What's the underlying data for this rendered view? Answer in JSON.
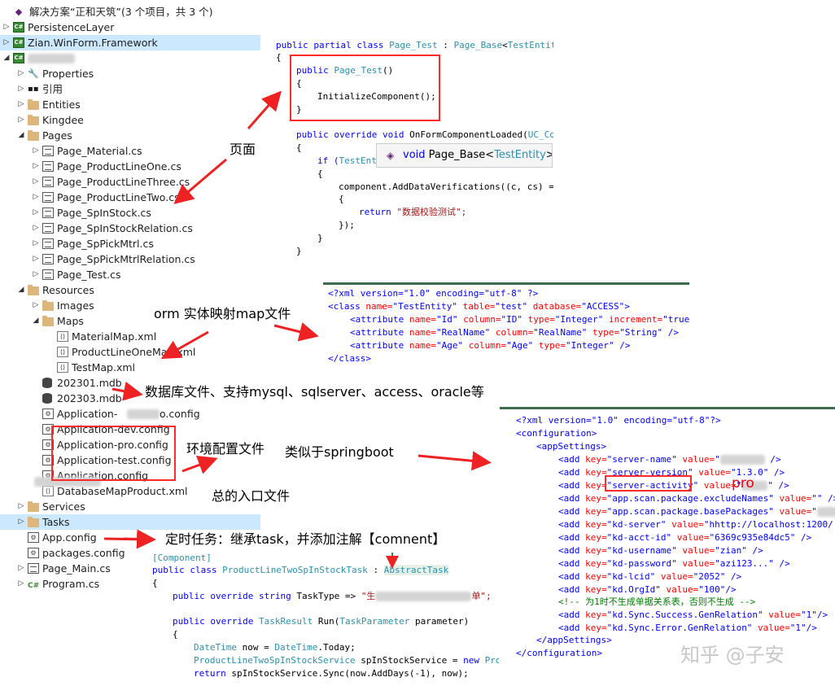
{
  "tree": {
    "solution": "解决方案“正和天筑”(3 个项目，共 3 个)",
    "items": [
      {
        "label": "PersistenceLayer"
      },
      {
        "label": "Zian.WinForm.Framework"
      },
      {
        "label": ""
      },
      {
        "label": "Properties"
      },
      {
        "label": "引用"
      },
      {
        "label": "Entities"
      },
      {
        "label": "Kingdee"
      },
      {
        "label": "Pages"
      },
      {
        "label": "Page_Material.cs"
      },
      {
        "label": "Page_ProductLineOne.cs"
      },
      {
        "label": "Page_ProductLineThree.cs"
      },
      {
        "label": "Page_ProductLineTwo.cs"
      },
      {
        "label": "Page_SpInStock.cs"
      },
      {
        "label": "Page_SpInStockRelation.cs"
      },
      {
        "label": "Page_SpPickMtrl.cs"
      },
      {
        "label": "Page_SpPickMtrlRelation.cs"
      },
      {
        "label": "Page_Test.cs"
      },
      {
        "label": "Resources"
      },
      {
        "label": "Images"
      },
      {
        "label": "Maps"
      },
      {
        "label": "MaterialMap.xml"
      },
      {
        "label": "ProductLineOneMap.xml"
      },
      {
        "label": "TestMap.xml"
      },
      {
        "label": "202301.mdb"
      },
      {
        "label": "202303.mdb"
      },
      {
        "label": "Application-"
      },
      {
        "label": "Application-dev.config"
      },
      {
        "label": "Application-pro.config"
      },
      {
        "label": "Application-test.config"
      },
      {
        "label": "Application.config"
      },
      {
        "label": "DatabaseMapProduct.xml"
      },
      {
        "label": "Services"
      },
      {
        "label": "Tasks"
      },
      {
        "label": "App.config"
      },
      {
        "label": "packages.config"
      },
      {
        "label": "Page_Main.cs"
      },
      {
        "label": "Program.cs"
      }
    ],
    "app_config_suffix": "o.config"
  },
  "code1": {
    "l1a": "public partial class ",
    "l1b": "Page_Test",
    "l1c": " : ",
    "l1d": "Page_Base",
    "l1e": "<",
    "l1f": "TestEntity",
    "l2": "{",
    "l3a": "public ",
    "l3b": "Page_Test",
    "l3c": "()",
    "l4": "{",
    "l5": "InitializeComponent();",
    "l6": "}",
    "l7a": "public override void ",
    "l7b": "OnFormComponentLoaded(",
    "l7c": "UC_Com",
    "l8": "{",
    "l9a": "if (",
    "l9b": "TestEnti",
    "l10": "{",
    "l11a": "component.",
    "l11b": "AddDataVerifications((c, cs) =>",
    "l12": "{",
    "l13a": "return ",
    "l13b": "\"数据校验测试\";",
    "l14": "});",
    "l15": "}",
    "l16": "}"
  },
  "tooltip": {
    "a": "void ",
    "b": "Page_Base",
    "c": "<",
    "d": "TestEntity",
    "e": ">.On"
  },
  "xml1": {
    "l1": "<?xml version=\"1.0\" encoding=\"utf-8\" ?>",
    "l2a": "<class ",
    "l2b": "name=",
    "l2c": "\"TestEntity\"",
    "l2d": " table=",
    "l2e": "\"test\"",
    "l2f": " database=",
    "l2g": "\"ACCESS\"",
    "l2h": ">",
    "l3a": "<attribute ",
    "l3b": "name=",
    "l3c": "\"Id\"",
    "l3d": " column=",
    "l3e": "\"ID\"",
    "l3f": " type=",
    "l3g": "\"Integer\"",
    "l3h": " increment=",
    "l3i": "\"true\"",
    "l4a": "<attribute ",
    "l4b": "name=",
    "l4c": "\"RealName\"",
    "l4d": " column=",
    "l4e": "\"RealName\"",
    "l4f": " type=",
    "l4g": "\"String\"",
    "l4h": " />",
    "l5a": "<attribute ",
    "l5b": "name=",
    "l5c": "\"Age\"",
    "l5d": " column=",
    "l5e": "\"Age\"",
    "l5f": " type=",
    "l5g": "\"Integer\"",
    "l5h": " />",
    "l6": "</class>"
  },
  "xml2": {
    "l1": "<?xml version=\"1.0\" encoding=\"utf-8\"?>",
    "l2": "<configuration>",
    "l3": "<appSettings>",
    "rows": [
      {
        "k": "\"server-name\"",
        "v": "\"",
        "t": " />"
      },
      {
        "k": "\"server-version\"",
        "v": "\"1.3.0\"",
        "t": " />"
      },
      {
        "k": "\"server-activity\"",
        "v": "\"",
        "t": "\" />"
      },
      {
        "k": "\"app.scan.package.excludeNames\"",
        "v": "\"\"",
        "t": " />"
      },
      {
        "k": "\"app.scan.package.basePackages\"",
        "v": "\"",
        "t": ""
      },
      {
        "k": "\"kd-server\"",
        "v": "\"hhttp://localhost:1200/",
        "t": ""
      },
      {
        "k": "\"kd-acct-id\"",
        "v": "\"6369c935e84dc5\"",
        "t": " />"
      },
      {
        "k": "\"kd-username\"",
        "v": "\"zian\"",
        "t": " />"
      },
      {
        "k": "\"kd-password\"",
        "v": "\"azi123...\"",
        "t": " />"
      },
      {
        "k": "\"kd-lcid\"",
        "v": "\"2052\"",
        "t": " />"
      },
      {
        "k": "\"kd.OrgId\"",
        "v": "\"100\"",
        "t": "/>"
      }
    ],
    "comment": "<!-- 为1时不生成单据关系表，否则不生成 -->",
    "rows2": [
      {
        "k": "\"kd.Sync.Success.GenRelation\"",
        "v": "\"1\"",
        "t": "/>"
      },
      {
        "k": "\"kd.Sync.Error.GenRelation\"",
        "v": "\"1\"",
        "t": "/>"
      }
    ],
    "l_end1": "</appSettings>",
    "l_end2": "</configuration>",
    "add": "<add ",
    "key": "key=",
    "value": " value=",
    "pro": "pro"
  },
  "code2": {
    "l1": "[Component]",
    "l2a": "public class ",
    "l2b": "ProductLineTwoSpInStockTask",
    "l2c": " : ",
    "l2d": "AbstractTask",
    "l3": "{",
    "l4a": "public override string ",
    "l4b": "TaskType => ",
    "l4c": "\"生",
    "l4d": "单\";",
    "l5a": "public override ",
    "l5b": "TaskResult",
    "l5c": " Run(",
    "l5d": "TaskParameter",
    "l5e": " parameter)",
    "l6": "{",
    "l7a": "DateTime",
    "l7b": " now = ",
    "l7c": "DateTime",
    "l7d": ".Today;",
    "l8a": "ProductLineTwoSpInStockService",
    "l8b": " spInStockService = ",
    "l8c": "new ",
    "l8d": "Produ",
    "l9a": "return ",
    "l9b": "spInStockService.Sync(now.AddDays(-1), now);"
  },
  "annotations": {
    "page": "页面",
    "orm": "orm 实体映射map文件",
    "db": "数据库文件、支持mysql、sqlserver、access、oracle等",
    "env": "环境配置文件",
    "spring": "类似于springboot",
    "entry": "总的入口文件",
    "task": "定时任务：继承task，并添加注解【comnent】"
  },
  "watermark": "知乎 @子安",
  "colors": {
    "highlight": "#ff2a2a",
    "keyword": "#0000ff",
    "type": "#2b91af",
    "string": "#a31515",
    "selection": "#cce8ff"
  }
}
